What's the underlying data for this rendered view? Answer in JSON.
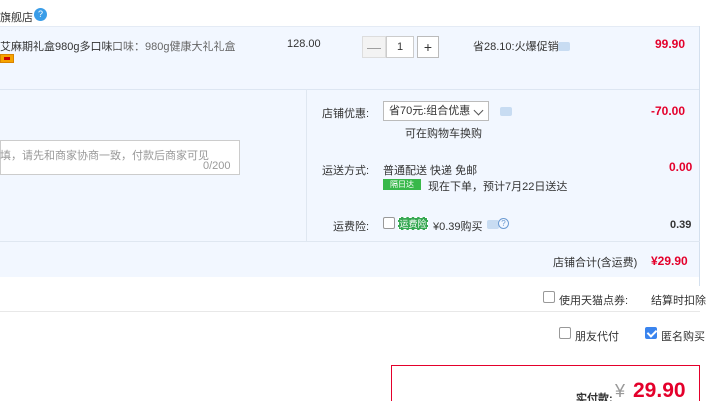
{
  "store": {
    "name": "旗舰店",
    "badge": "?"
  },
  "item": {
    "title": "艾麻期礼盒980g多口味...",
    "spec": "口味：980g健康大礼礼盒",
    "unit_price": "128.00",
    "qty_minus": "—",
    "quantity": "1",
    "qty_plus": "+",
    "saving": "省28.10:火爆促销",
    "total": "99.90"
  },
  "memo": {
    "placeholder": "填，请先和商家协商一致，付款后商家可见",
    "count": "0/200"
  },
  "promo": {
    "label": "店铺优惠:",
    "selected": "省70元:组合优惠",
    "note": "可在购物车换购",
    "amount": "-70.00"
  },
  "shipping": {
    "label": "运送方式:",
    "method": "普通配送 快递 免邮",
    "badge": "隔日达",
    "eta": "现在下单，预计7月22日送达",
    "amount": "0.00"
  },
  "insurance": {
    "label": "运费险:",
    "badge": "运费险",
    "price": "¥0.39购买",
    "help": "?",
    "amount": "0.39"
  },
  "subtotal": {
    "label": "店铺合计(含运费)",
    "amount": "¥29.90"
  },
  "options": {
    "tmall_points": "使用天猫点券:",
    "settle_note": "结算时扣除",
    "friend_pay": "朋友代付",
    "anonymous": "匿名购买",
    "anonymous_checked": true
  },
  "payment": {
    "label": "实付款:",
    "currency": "¥",
    "amount": "29.90"
  },
  "colors": {
    "accent_red": "#e4002b",
    "panel_bg": "#f2f7ff",
    "checkbox_blue": "#3a84ee",
    "green_badge": "#38b84a"
  },
  "icons": [
    "info-badge-icon",
    "chat-icon",
    "chevron-down-icon",
    "help-icon",
    "checkbox-icon"
  ]
}
